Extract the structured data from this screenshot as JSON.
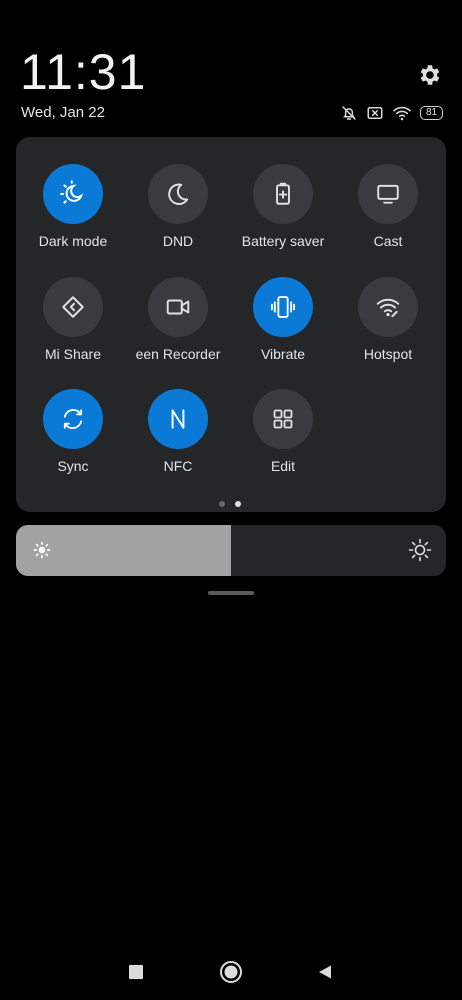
{
  "status": {
    "time": "11:31",
    "date": "Wed, Jan 22",
    "battery_level": "81"
  },
  "quick_settings": {
    "tiles": [
      {
        "id": "dark-mode",
        "label": "Dark mode",
        "active": true,
        "icon": "dark-mode-icon"
      },
      {
        "id": "dnd",
        "label": "DND",
        "active": false,
        "icon": "moon-icon"
      },
      {
        "id": "battery-saver",
        "label": "Battery saver",
        "active": false,
        "icon": "battery-saver-icon"
      },
      {
        "id": "cast",
        "label": "Cast",
        "active": false,
        "icon": "cast-icon"
      },
      {
        "id": "mi-share",
        "label": "Mi Share",
        "active": false,
        "icon": "mi-share-icon"
      },
      {
        "id": "screen-recorder",
        "label": "een Recorder",
        "active": false,
        "icon": "video-camera-icon"
      },
      {
        "id": "vibrate",
        "label": "Vibrate",
        "active": true,
        "icon": "vibrate-icon"
      },
      {
        "id": "hotspot",
        "label": "Hotspot",
        "active": false,
        "icon": "hotspot-icon"
      },
      {
        "id": "sync",
        "label": "Sync",
        "active": true,
        "icon": "sync-icon"
      },
      {
        "id": "nfc",
        "label": "NFC",
        "active": true,
        "icon": "nfc-icon"
      },
      {
        "id": "edit",
        "label": "Edit",
        "active": false,
        "icon": "grid-icon"
      }
    ],
    "pages": 2,
    "current_page": 2
  },
  "brightness": {
    "level": 0.5
  },
  "colors": {
    "accent": "#0a7ad6",
    "panel": "#252628",
    "tile_inactive": "#3a3b3e",
    "brightness_fill": "#a2a2a2"
  }
}
